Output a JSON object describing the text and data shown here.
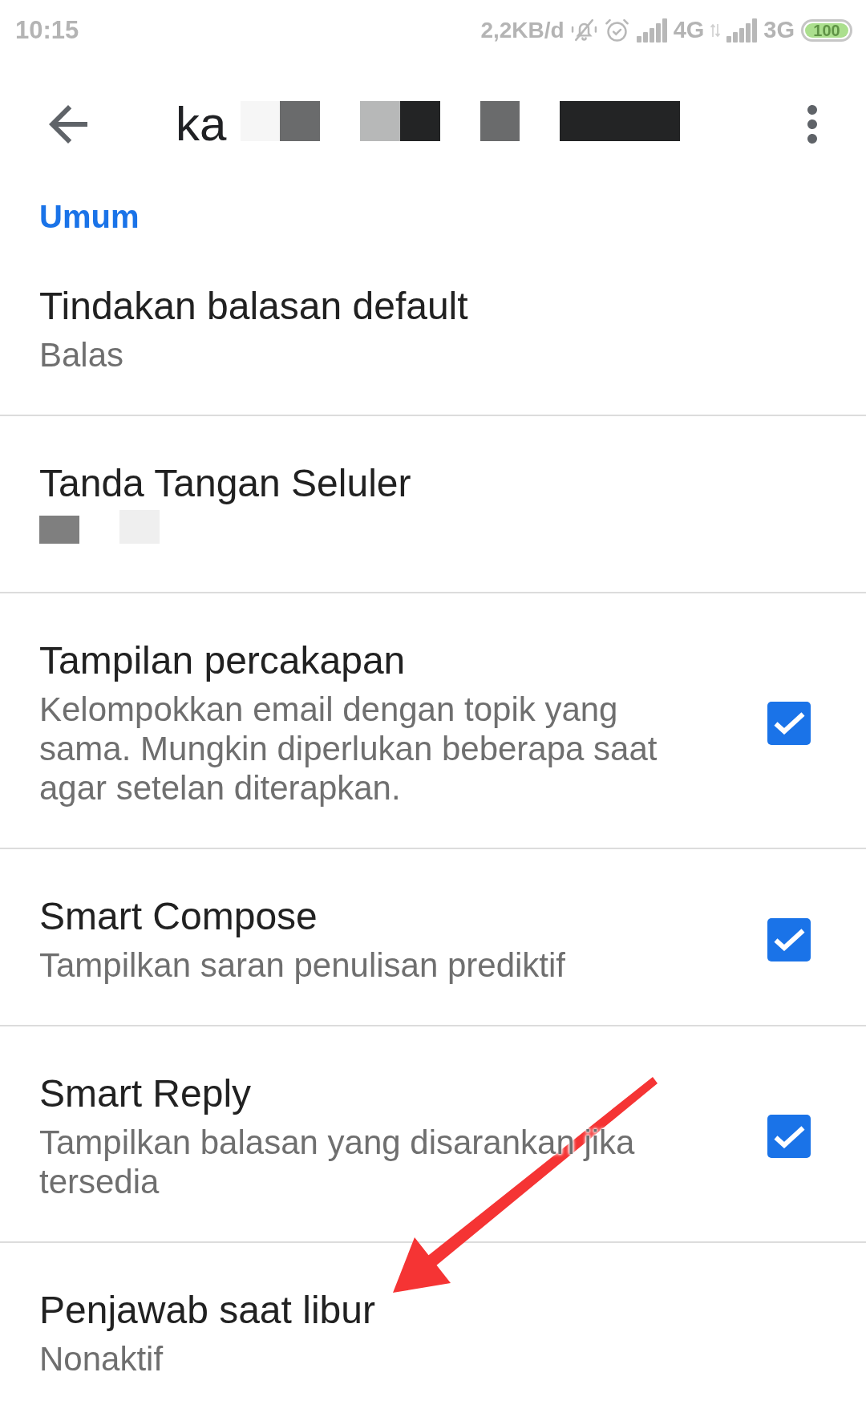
{
  "status_bar": {
    "time": "10:15",
    "data_rate": "2,2KB/d",
    "sim_1_network": "4G",
    "sim_2_network": "3G",
    "battery": "100"
  },
  "toolbar": {
    "title": "ka"
  },
  "section": {
    "title": "Umum"
  },
  "settings": [
    {
      "kind": "text",
      "title": "Tindakan balasan default",
      "summary": "Balas"
    },
    {
      "kind": "redacted",
      "title": "Tanda Tangan Seluler"
    },
    {
      "kind": "checkbox",
      "title": "Tampilan percakapan",
      "summary": "Kelompokkan email dengan topik yang sama. Mungkin diperlukan beberapa saat agar setelan diterapkan.",
      "checked": true
    },
    {
      "kind": "checkbox",
      "title": "Smart Compose",
      "summary": "Tampilkan saran penulisan prediktif",
      "checked": true
    },
    {
      "kind": "checkbox",
      "title": "Smart Reply",
      "summary": "Tampilkan balasan yang disarankan jika tersedia",
      "checked": true
    },
    {
      "kind": "text",
      "title": "Penjawab saat libur",
      "summary": "Nonaktif"
    }
  ]
}
